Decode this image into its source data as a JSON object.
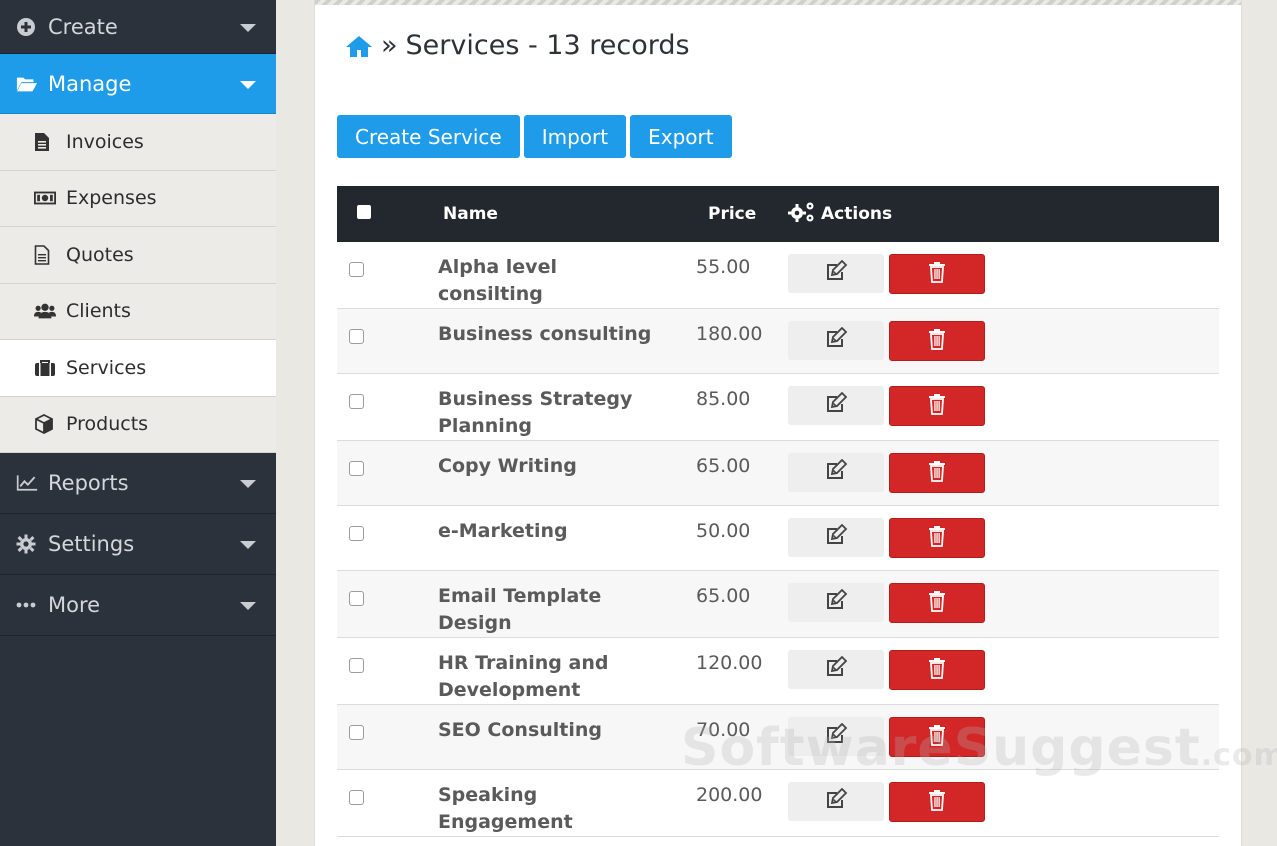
{
  "sidebar": {
    "create_label": "Create",
    "manage_label": "Manage",
    "items": [
      {
        "label": "Invoices",
        "icon": "file-text-icon"
      },
      {
        "label": "Expenses",
        "icon": "money-icon"
      },
      {
        "label": "Quotes",
        "icon": "file-icon"
      },
      {
        "label": "Clients",
        "icon": "users-icon"
      },
      {
        "label": "Services",
        "icon": "briefcase-icon"
      },
      {
        "label": "Products",
        "icon": "cube-icon"
      }
    ],
    "reports_label": "Reports",
    "settings_label": "Settings",
    "more_label": "More"
  },
  "page": {
    "breadcrumb_sep": "»",
    "title": "Services - 13 records"
  },
  "toolbar": {
    "create_label": "Create Service",
    "import_label": "Import",
    "export_label": "Export"
  },
  "table": {
    "headers": {
      "name": "Name",
      "price": "Price",
      "actions": "Actions"
    },
    "rows": [
      {
        "name": "Alpha level consilting",
        "price": "55.00"
      },
      {
        "name": "Business consulting",
        "price": "180.00"
      },
      {
        "name": "Business Strategy Planning",
        "price": "85.00"
      },
      {
        "name": "Copy Writing",
        "price": "65.00"
      },
      {
        "name": "e-Marketing",
        "price": "50.00"
      },
      {
        "name": "Email Template Design",
        "price": "65.00"
      },
      {
        "name": "HR Training and Development",
        "price": "120.00"
      },
      {
        "name": "SEO Consulting",
        "price": "70.00"
      },
      {
        "name": "Speaking Engagement",
        "price": "200.00"
      }
    ]
  },
  "watermark": {
    "main": "SoftwareSuggest",
    "suffix": ".com"
  },
  "colors": {
    "accent": "#1e9be9",
    "sidebar": "#2b323b",
    "danger": "#d32626",
    "table_header": "#23282e"
  }
}
